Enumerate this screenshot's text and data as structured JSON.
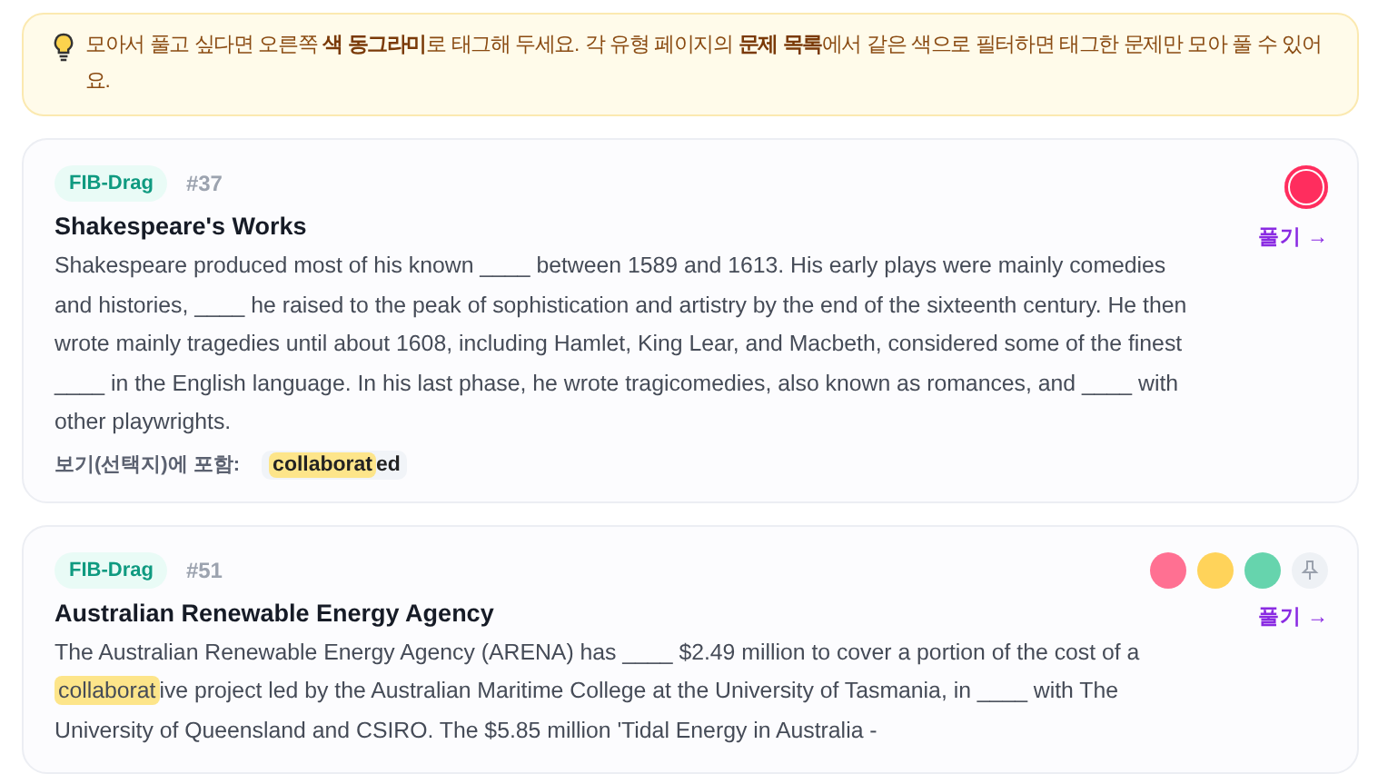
{
  "notice": {
    "text": "모아서 풀고 싶다면 오른쪽 **색 동그라미**로 태그해 두세요. 각 유형 페이지의 **문제 목록**에서 같은 색으로 필터하면 태그한 문제만 모아 풀 수 있어요."
  },
  "cards": [
    {
      "type": "FIB-Drag",
      "number": "#37",
      "title": "Shakespeare's Works",
      "tags": [
        {
          "color": "#ff2d5e",
          "selected": true
        }
      ],
      "pin": false,
      "action": "풀기 →",
      "passage": [
        {
          "text": "Shakespeare produced most of his known ____ between 1589 and 1613. His early plays were mainly comedies and histories, ____ he raised to the peak of sophistication and artistry by the end of the sixteenth century. He then wrote mainly tragedies until about 1608, including Hamlet, King Lear, and Macbeth, considered some of the finest ____ in the English language. In his last phase, he wrote tragicomedies, also known as romances, and ____ with other playwrights.",
          "highlighted": false
        }
      ],
      "choices_label": "보기(선택지)에 포함:",
      "choice": [
        {
          "text": "collaborat",
          "highlighted": true
        },
        {
          "text": "ed",
          "highlighted": false
        }
      ]
    },
    {
      "type": "FIB-Drag",
      "number": "#51",
      "title": "Australian Renewable Energy Agency",
      "tags": [
        {
          "color": "#ff7092",
          "selected": false
        },
        {
          "color": "#ffd35a",
          "selected": false
        },
        {
          "color": "#66d4ad",
          "selected": false
        }
      ],
      "pin": true,
      "action": "풀기 →",
      "passage": [
        {
          "text": "The Australian Renewable Energy Agency (ARENA) has ____ $2.49 million to cover a portion of the cost of a ",
          "highlighted": false
        },
        {
          "text": "collaborat",
          "highlighted": true
        },
        {
          "text": "ive project led by the Australian Maritime College at the University of Tasmania, in ____ with The University of Queensland and CSIRO. The $5.85 million 'Tidal Energy in Australia -",
          "highlighted": false
        }
      ]
    }
  ]
}
